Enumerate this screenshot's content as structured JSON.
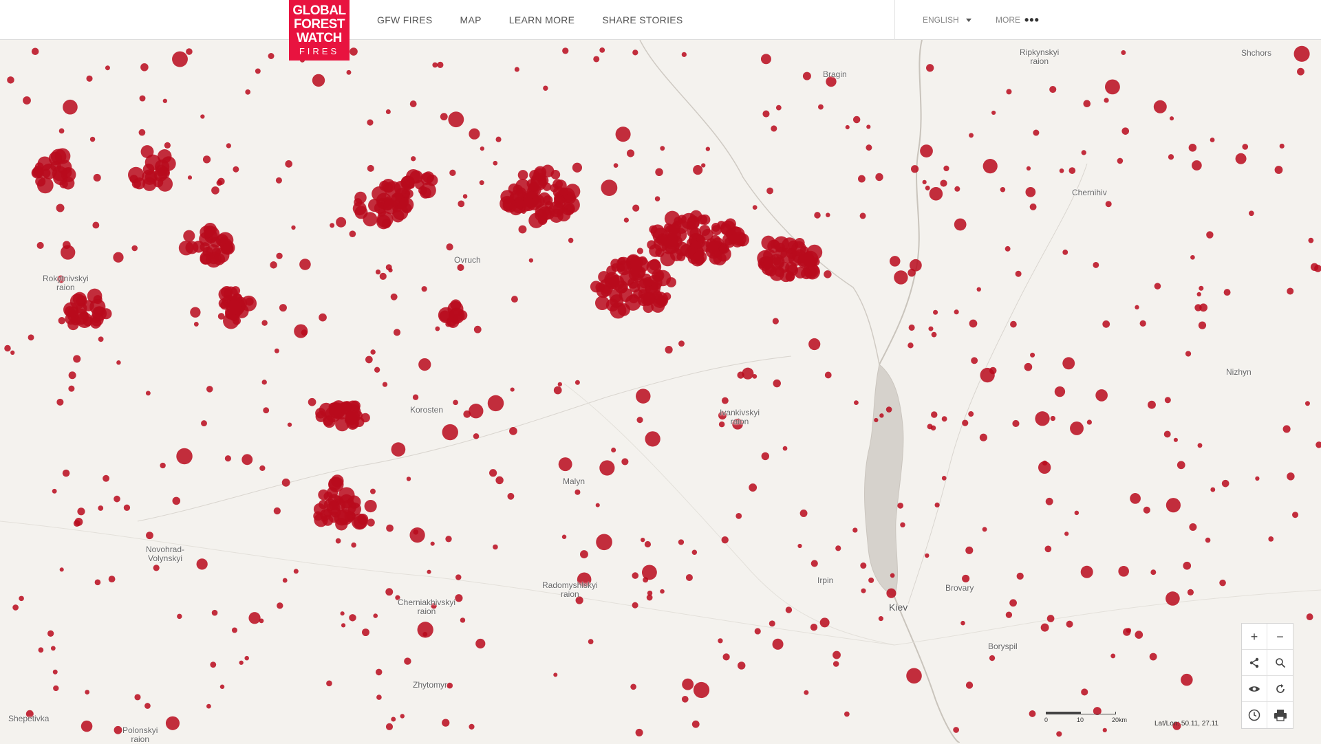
{
  "header": {
    "logo": {
      "line1": "GLOBAL",
      "line2": "FOREST",
      "line3": "WATCH",
      "line4": "FIRES"
    },
    "nav": [
      "GFW FIRES",
      "MAP",
      "LEARN MORE",
      "SHARE STORIES"
    ],
    "language": "ENGLISH",
    "more": "MORE",
    "brand_color": "#e8133f"
  },
  "map": {
    "fire_color": "#b90a1c",
    "cities": [
      {
        "name": "Bragin"
      },
      {
        "name": "Ripkynskyi\nraion"
      },
      {
        "name": "Shchors"
      },
      {
        "name": "Chernihiv"
      },
      {
        "name": "Rokytnivskyi\nraion"
      },
      {
        "name": "Ovruch"
      },
      {
        "name": "Korosten"
      },
      {
        "name": "Ivankivskyi\nraion"
      },
      {
        "name": "Malyn"
      },
      {
        "name": "Nizhyn"
      },
      {
        "name": "Novohrad-\nVolynskyi"
      },
      {
        "name": "Radomyshlskyi\nraion"
      },
      {
        "name": "Cherniakhivskyi\nraion"
      },
      {
        "name": "Irpin"
      },
      {
        "name": "Kiev"
      },
      {
        "name": "Brovary"
      },
      {
        "name": "Boryspil"
      },
      {
        "name": "Zhytomyr"
      },
      {
        "name": "Shepetivka"
      },
      {
        "name": "Polonskyi\nraion"
      }
    ],
    "scale": {
      "ticks": [
        "0",
        "10",
        "20km"
      ]
    },
    "latlon": "Lat/Lon: 50.11, 27.11"
  },
  "controls": {
    "icons": [
      "zoom-in-icon",
      "zoom-out-icon",
      "share-icon",
      "search-icon",
      "eye-icon",
      "refresh-icon",
      "clock-icon",
      "print-icon"
    ]
  }
}
